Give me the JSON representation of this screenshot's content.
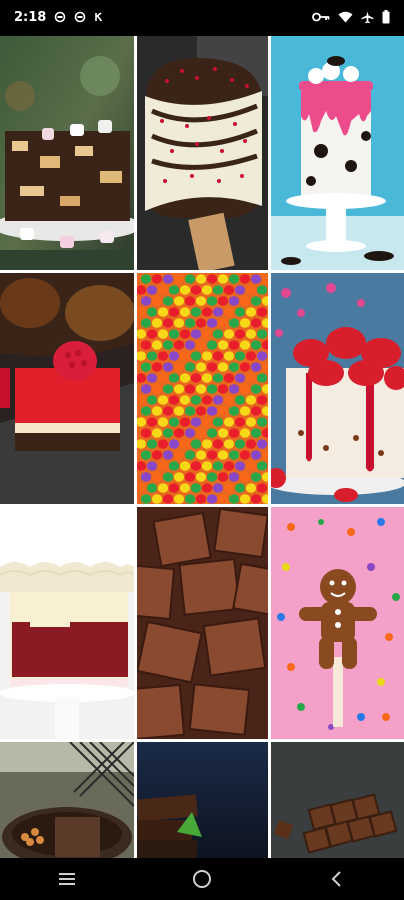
{
  "status_bar": {
    "time": "2:18",
    "left_icons": [
      "sync-icon",
      "sync-icon",
      "notification-k-icon"
    ],
    "right_icons": [
      "vpn-key-icon",
      "wifi-icon",
      "airplane-icon",
      "battery-icon"
    ]
  },
  "grid": {
    "tiles": [
      {
        "name": "tile-chocolate-marshmallow-cake",
        "subject": "chocolate-marshmallow-cake"
      },
      {
        "name": "tile-chocolate-popsicle",
        "subject": "chocolate-popsicle"
      },
      {
        "name": "tile-drip-cake-oreo",
        "subject": "drip-cake-oreo"
      },
      {
        "name": "tile-raspberry-cake-slice",
        "subject": "raspberry-cake-slice"
      },
      {
        "name": "tile-colorful-candies",
        "subject": "colorful-candies"
      },
      {
        "name": "tile-strawberry-cheesecake",
        "subject": "strawberry-cheesecake"
      },
      {
        "name": "tile-red-velvet-cake",
        "subject": "red-velvet-cake"
      },
      {
        "name": "tile-cocoa-truffles",
        "subject": "cocoa-truffles"
      },
      {
        "name": "tile-gingerbread-lollipop",
        "subject": "gingerbread-lollipop"
      },
      {
        "name": "tile-chocolate-tart",
        "subject": "chocolate-tart"
      },
      {
        "name": "tile-dark-chocolate-pieces",
        "subject": "dark-chocolate-pieces"
      },
      {
        "name": "tile-chocolate-bar-blocks",
        "subject": "chocolate-bar-blocks"
      }
    ]
  },
  "nav_bar": {
    "buttons": [
      "recents-icon",
      "home-icon",
      "back-icon"
    ]
  },
  "colors": {
    "status_bar_bg": "#000000",
    "nav_bar_bg": "#000000",
    "grid_gap": "#ffffff"
  }
}
